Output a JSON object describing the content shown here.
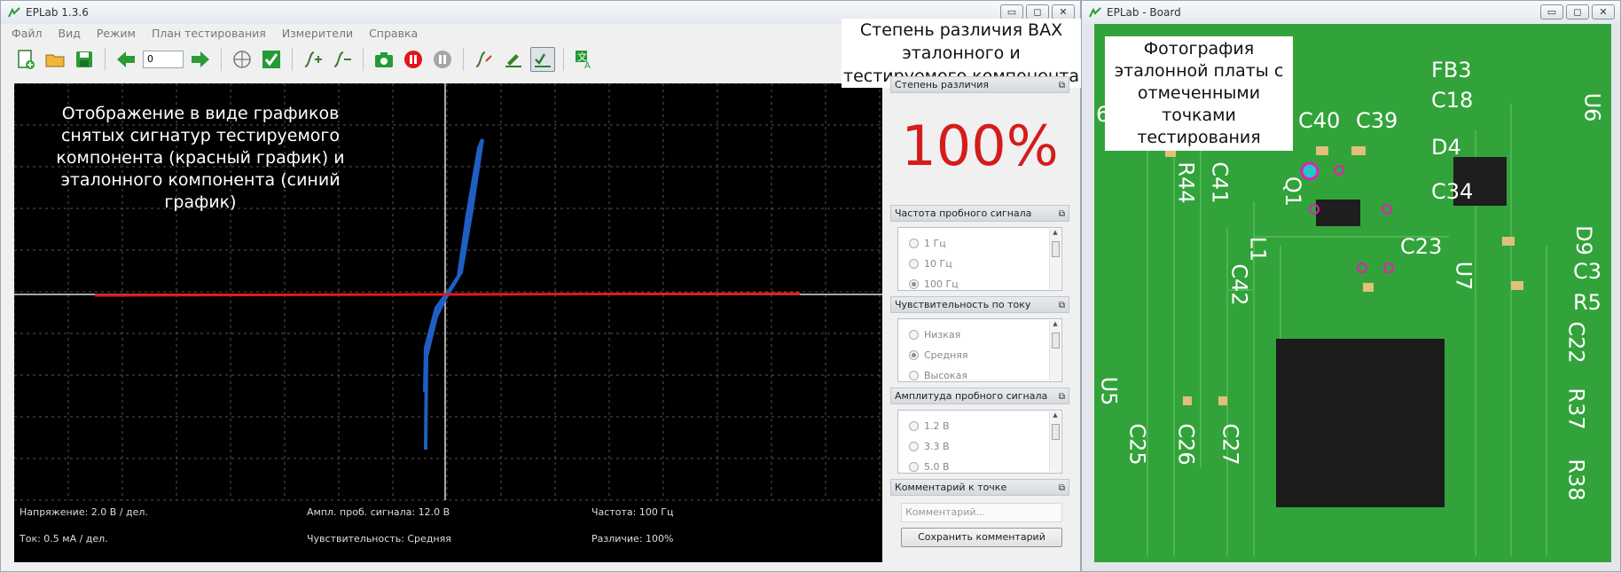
{
  "main": {
    "title": "EPLab 1.3.6",
    "menu": [
      "Файл",
      "Вид",
      "Режим",
      "План тестирования",
      "Измерители",
      "Справка"
    ],
    "toolbar": {
      "spin_value": "0"
    },
    "overlay_text": "Отображение в виде графиков снятых сигнатур тестируемого компонента (красный график) и эталонного компонента (синий график)",
    "annotation_top": "Степень различия ВАХ эталонного и тестируемого компонента",
    "stats": {
      "voltage": "Напряжение: 2.0 В / дел.",
      "amplitude": "Ампл. проб. сигнала: 12.0 В",
      "frequency": "Частота: 100 Гц",
      "current": "Ток: 0.5 мА / дел.",
      "sensitivity": "Чувствительность: Средняя",
      "difference": "Различие: 100%"
    },
    "side": {
      "difference_header": "Степень различия",
      "difference_value": "100%",
      "freq_header": "Частота пробного сигнала",
      "freq_options": [
        "1 Гц",
        "10 Гц",
        "100 Гц"
      ],
      "sens_header": "Чувствительность по току",
      "sens_options": [
        "Низкая",
        "Средняя",
        "Высокая"
      ],
      "amp_header": "Амплитуда пробного сигнала",
      "amp_options": [
        "1.2 В",
        "3.3 В",
        "5.0 В"
      ],
      "comment_header": "Комментарий к точке",
      "comment_placeholder": "Комментарий...",
      "save_button": "Сохранить комментарий"
    },
    "colors": {
      "reference_curve": "#1f5fc4",
      "test_curve": "#e11b1b",
      "difference": "#d51c1c"
    }
  },
  "board": {
    "title": "EPLab - Board",
    "annotation": "Фотография эталонной платы с отмеченными точками тестирования",
    "silk_labels": [
      "FB3",
      "C18",
      "U6",
      "C40",
      "C39",
      "D4",
      "R44",
      "C41",
      "Q1",
      "C34",
      "L1",
      "C23",
      "D9",
      "C42",
      "U7",
      "C3",
      "R5",
      "C22",
      "R37",
      "U5",
      "C25",
      "C26",
      "C27",
      "R38",
      "6"
    ]
  }
}
